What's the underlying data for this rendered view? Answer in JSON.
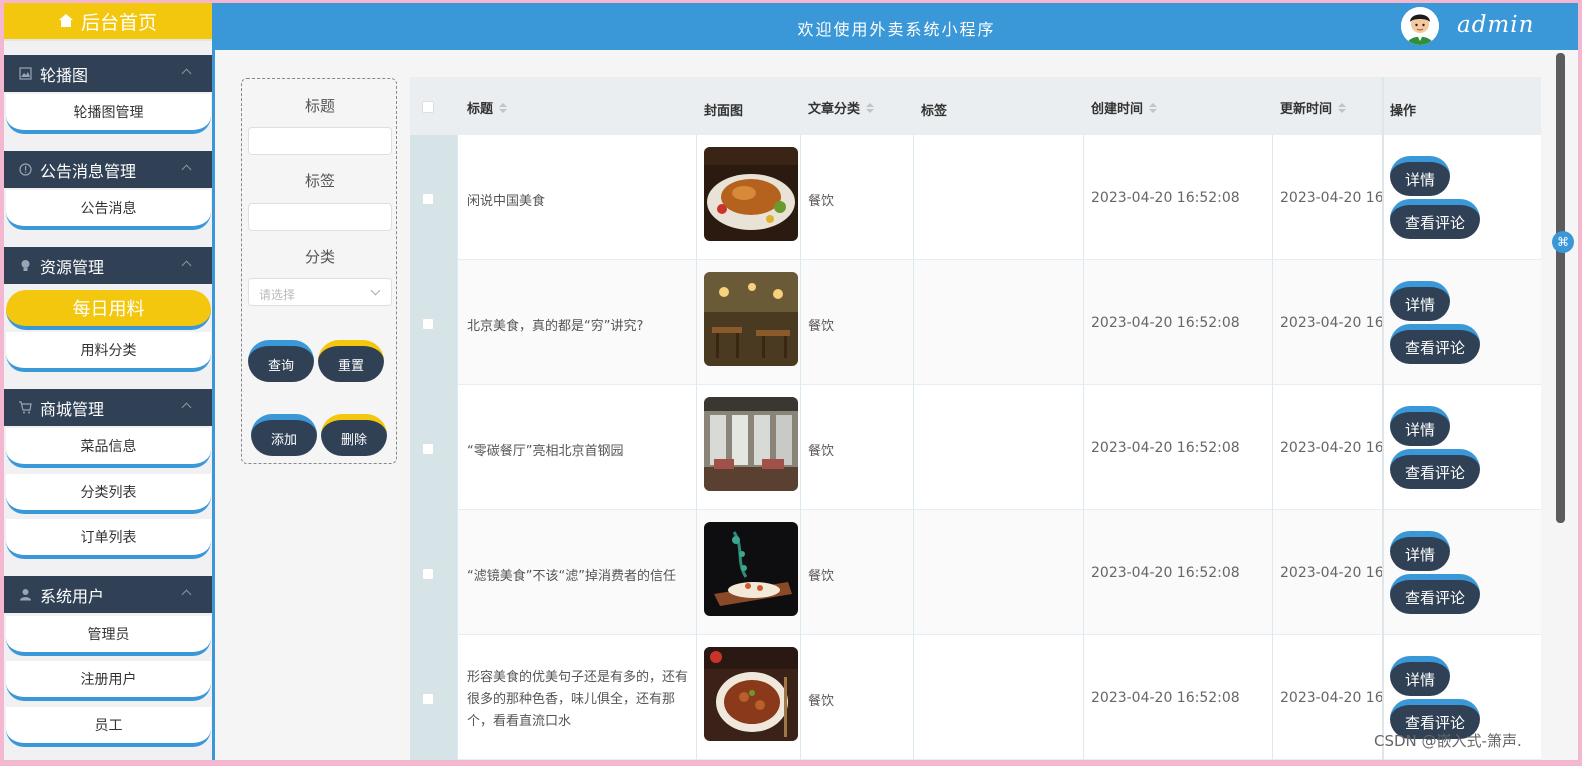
{
  "sidebar": {
    "home_label": "后台首页",
    "groups": [
      {
        "title": "轮播图",
        "icon": "image-icon",
        "items": [
          "轮播图管理"
        ]
      },
      {
        "title": "公告消息管理",
        "icon": "info-icon",
        "items": [
          "公告消息"
        ]
      },
      {
        "title": "资源管理",
        "icon": "bulb-icon",
        "items": [
          "每日用料",
          "用料分类"
        ]
      },
      {
        "title": "商城管理",
        "icon": "cart-icon",
        "items": [
          "菜品信息",
          "分类列表",
          "订单列表"
        ]
      },
      {
        "title": "系统用户",
        "icon": "user-icon",
        "items": [
          "管理员",
          "注册用户",
          "员工"
        ]
      }
    ],
    "active_item": "每日用料"
  },
  "header": {
    "title": "欢迎使用外卖系统小程序",
    "username": "admin"
  },
  "filter": {
    "title_label": "标题",
    "tag_label": "标签",
    "category_label": "分类",
    "category_placeholder": "请选择",
    "title_value": "",
    "tag_value": "",
    "query_label": "查询",
    "reset_label": "重置",
    "add_label": "添加",
    "delete_label": "删除"
  },
  "table": {
    "columns": [
      "标题",
      "封面图",
      "文章分类",
      "标签",
      "创建时间",
      "更新时间",
      "操作"
    ],
    "rows": [
      {
        "title": "闲说中国美食",
        "category": "餐饮",
        "tag": "",
        "created": "2023-04-20 16:52:08",
        "updated": "2023-04-20 16",
        "thumb": "roast-dish"
      },
      {
        "title": "北京美食，真的都是“穷”讲究?",
        "category": "餐饮",
        "tag": "",
        "created": "2023-04-20 16:52:08",
        "updated": "2023-04-20 16",
        "thumb": "restaurant-interior"
      },
      {
        "title": "“零碳餐厅”亮相北京首钢园",
        "category": "餐饮",
        "tag": "",
        "created": "2023-04-20 16:52:08",
        "updated": "2023-04-20 16",
        "thumb": "dining-hall"
      },
      {
        "title": "“滤镜美食”不该“滤”掉消费者的信任",
        "category": "餐饮",
        "tag": "",
        "created": "2023-04-20 16:52:08",
        "updated": "2023-04-20 16",
        "thumb": "plated-dish"
      },
      {
        "title": "形容美食的优美句子还是有多的，还有很多的那种色香，味儿俱全，还有那个，看看直流口水",
        "category": "餐饮",
        "tag": "",
        "created": "2023-04-20 16:52:08",
        "updated": "2023-04-20 16",
        "thumb": "braised-dish"
      }
    ],
    "action_detail": "详情",
    "action_comments": "查看评论"
  },
  "watermark": "CSDN @嵌入式-箫声.",
  "colors": {
    "primary": "#3a98d8",
    "accent": "#f2c70d",
    "dark": "#304156"
  }
}
